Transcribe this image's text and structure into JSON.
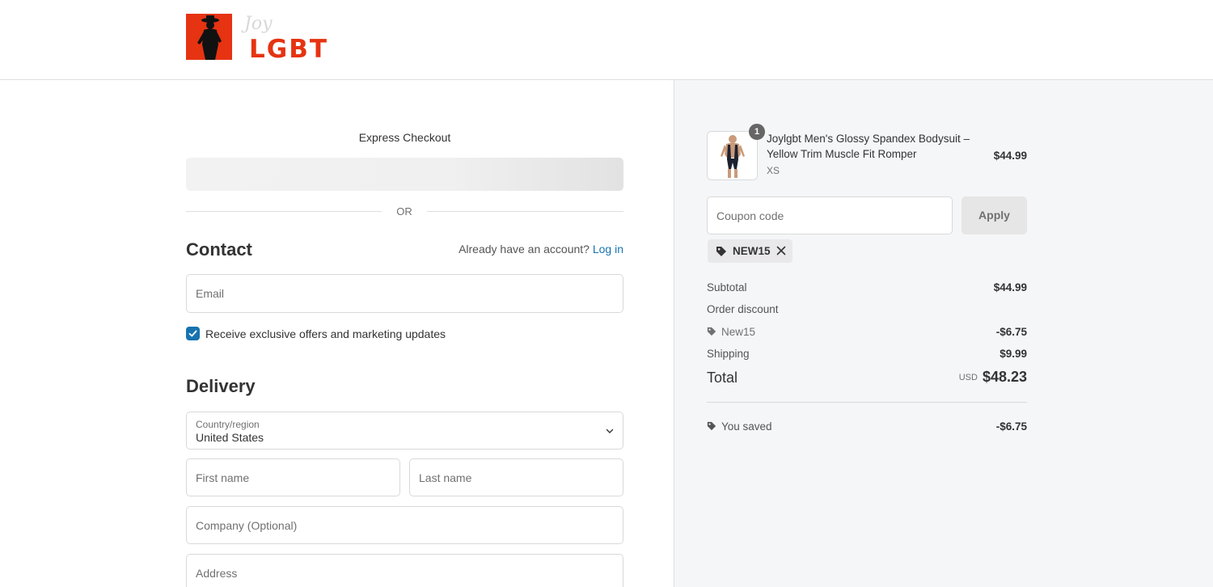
{
  "brand": {
    "logo_text": "LGBT",
    "logo_script": "Joy",
    "accent": "#e63312"
  },
  "express": {
    "title": "Express Checkout",
    "or_label": "OR"
  },
  "contact": {
    "heading": "Contact",
    "account_prompt": "Already have an account?",
    "login_link": "Log in",
    "email_placeholder": "Email",
    "marketing_label": "Receive exclusive offers and marketing updates",
    "marketing_checked": true
  },
  "delivery": {
    "heading": "Delivery",
    "country_label": "Country/region",
    "country_value": "United States",
    "first_name_placeholder": "First name",
    "last_name_placeholder": "Last name",
    "company_placeholder": "Company (Optional)",
    "address_placeholder": "Address"
  },
  "order": {
    "item": {
      "title": "Joylgbt Men's Glossy Spandex Bodysuit – Yellow Trim Muscle Fit Romper",
      "variant": "XS",
      "price": "$44.99",
      "quantity": "1"
    },
    "coupon_placeholder": "Coupon code",
    "apply_label": "Apply",
    "applied_code": "NEW15",
    "subtotal_label": "Subtotal",
    "subtotal_value": "$44.99",
    "discount_label": "Order discount",
    "discount_code": "New15",
    "discount_value": "-$6.75",
    "shipping_label": "Shipping",
    "shipping_value": "$9.99",
    "total_label": "Total",
    "currency": "USD",
    "total_value": "$48.23",
    "saved_label": "You saved",
    "saved_value": "-$6.75"
  },
  "colors": {
    "link": "#1773b0",
    "sidebar_bg": "#f5f6f8"
  }
}
